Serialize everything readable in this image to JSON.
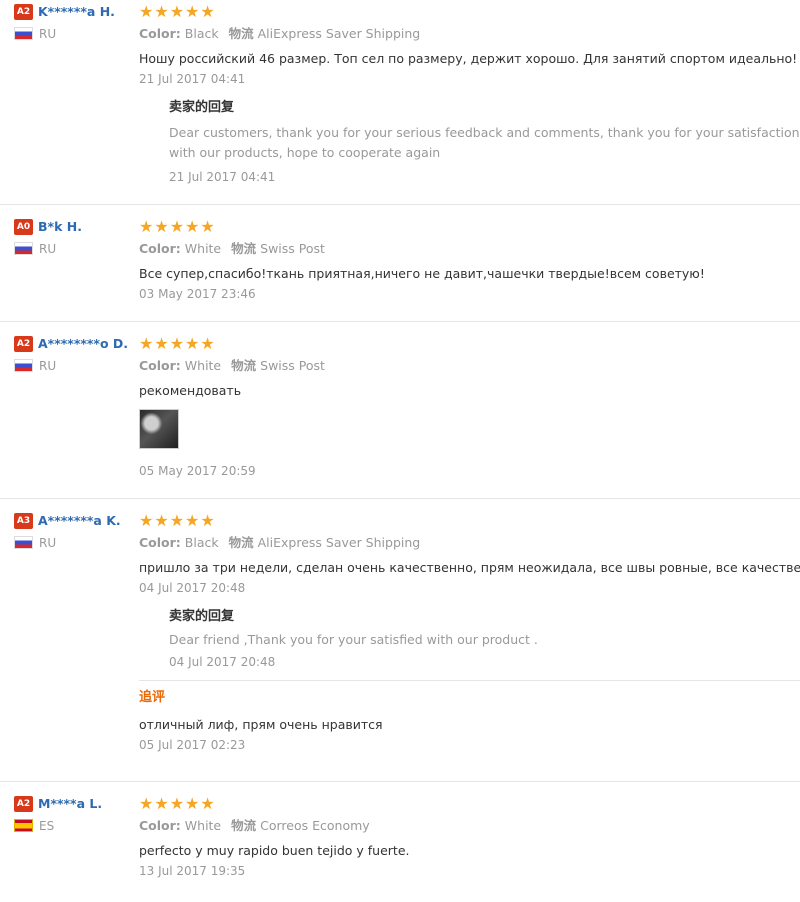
{
  "reviews": [
    {
      "level": "A2",
      "user": "K******a H.",
      "country": "RU",
      "flag": "ru",
      "stars": "★★★★★",
      "color_label": "Color:",
      "color_value": "Black",
      "shipping_label": "物流",
      "shipping_value": "AliExpress Saver Shipping",
      "text": "Ношу российский 46 размер. Топ сел по размеру, держит хорошо. Для занятий спортом идеально!",
      "date": "21 Jul 2017 04:41",
      "reply": {
        "title": "卖家的回复",
        "text": "Dear customers, thank you for your serious feedback and comments, thank you for your satisfaction with our products, hope to cooperate again",
        "date": "21 Jul 2017 04:41"
      }
    },
    {
      "level": "A0",
      "user": "B*k H.",
      "country": "RU",
      "flag": "ru",
      "stars": "★★★★★",
      "color_label": "Color:",
      "color_value": "White",
      "shipping_label": "物流",
      "shipping_value": "Swiss Post",
      "text": "Все супер,спасибо!ткань приятная,ничего не давит,чашечки твердые!всем советую!",
      "date": "03 May 2017 23:46"
    },
    {
      "level": "A2",
      "user": "A********o D.",
      "country": "RU",
      "flag": "ru",
      "stars": "★★★★★",
      "color_label": "Color:",
      "color_value": "White",
      "shipping_label": "物流",
      "shipping_value": "Swiss Post",
      "text": "рекомендовать",
      "date": "05 May 2017 20:59"
    },
    {
      "level": "A3",
      "user": "A*******a K.",
      "country": "RU",
      "flag": "ru",
      "stars": "★★★★★",
      "color_label": "Color:",
      "color_value": "Black",
      "shipping_label": "物流",
      "shipping_value": "AliExpress Saver Shipping",
      "text": "пришло за три недели, сделан очень качественно, прям неожидала, все швы ровные, все качественно",
      "date": "04 Jul 2017 20:48",
      "reply": {
        "title": "卖家的回复",
        "text": "Dear friend ,Thank you for your satisfied with our product .",
        "date": "04 Jul 2017 20:48"
      },
      "additional": {
        "title": "追评",
        "text": "отличный лиф, прям очень нравится",
        "date": "05 Jul 2017 02:23"
      }
    },
    {
      "level": "A2",
      "user": "M****a L.",
      "country": "ES",
      "flag": "es",
      "stars": "★★★★★",
      "color_label": "Color:",
      "color_value": "White",
      "shipping_label": "物流",
      "shipping_value": "Correos Economy",
      "text": "perfecto y muy rapido buen tejido y fuerte.",
      "date": "13 Jul 2017 19:35"
    }
  ]
}
